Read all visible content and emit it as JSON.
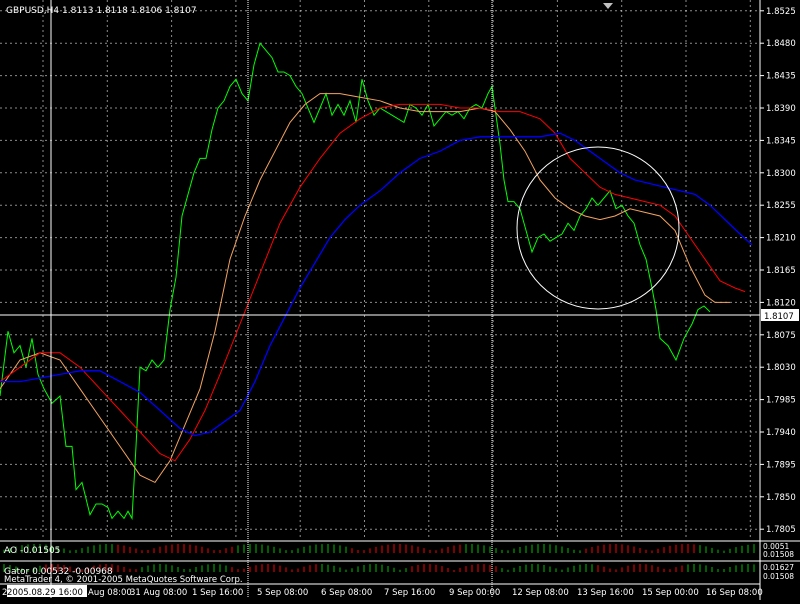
{
  "chart": {
    "symbol_info": "GBPUSD,H4  1.8113 1.8118 1.8106 1.8107",
    "current_price": "1.8107",
    "price_ticks": [
      "1.8525",
      "1.8480",
      "1.8435",
      "1.8390",
      "1.8345",
      "1.8300",
      "1.8255",
      "1.8210",
      "1.8165",
      "1.8120",
      "1.8075",
      "1.8030",
      "1.7985",
      "1.7940",
      "1.7895",
      "1.7850",
      "1.7805"
    ],
    "date_ticks": [
      "26",
      "2005.08.29 16:00",
      "Aug 08:00",
      "31 Aug 08:00",
      "1 Sep 16:00",
      "5 Sep 08:00",
      "6 Sep 08:00",
      "7 Sep 16:00",
      "9 Sep 00:00",
      "12 Sep 08:00",
      "13 Sep 16:00",
      "15 Sep 00:00",
      "16 Sep 08:00"
    ],
    "date_tick_x": [
      2,
      7,
      88,
      130,
      192,
      257,
      321,
      384,
      449,
      512,
      577,
      642,
      706
    ],
    "colors": {
      "background": "#000000",
      "grid": "#ffffff",
      "price_line": "#00ff00",
      "ma_fast": "#f4a460",
      "ma_mid": "#ff0000",
      "ma_slow": "#0000ff",
      "circle": "#ffffff"
    }
  },
  "chart_data": {
    "type": "line",
    "ylim": [
      1.779,
      1.854
    ],
    "series": [
      {
        "key": "price",
        "values": [
          [
            0,
            1.799
          ],
          [
            8,
            1.808
          ],
          [
            14,
            1.805
          ],
          [
            20,
            1.806
          ],
          [
            26,
            1.803
          ],
          [
            32,
            1.807
          ],
          [
            38,
            1.802
          ],
          [
            44,
            1.8
          ],
          [
            52,
            1.798
          ],
          [
            60,
            1.799
          ],
          [
            66,
            1.792
          ],
          [
            72,
            1.792
          ],
          [
            76,
            1.786
          ],
          [
            82,
            1.787
          ],
          [
            90,
            1.7825
          ],
          [
            96,
            1.784
          ],
          [
            102,
            1.784
          ],
          [
            108,
            1.7835
          ],
          [
            112,
            1.782
          ],
          [
            118,
            1.783
          ],
          [
            124,
            1.782
          ],
          [
            128,
            1.783
          ],
          [
            132,
            1.782
          ],
          [
            136,
            1.792
          ],
          [
            140,
            1.803
          ],
          [
            146,
            1.8025
          ],
          [
            152,
            1.804
          ],
          [
            158,
            1.803
          ],
          [
            164,
            1.804
          ],
          [
            170,
            1.811
          ],
          [
            176,
            1.8155
          ],
          [
            182,
            1.824
          ],
          [
            188,
            1.827
          ],
          [
            194,
            1.83
          ],
          [
            200,
            1.832
          ],
          [
            206,
            1.832
          ],
          [
            212,
            1.836
          ],
          [
            218,
            1.839
          ],
          [
            224,
            1.84
          ],
          [
            230,
            1.842
          ],
          [
            236,
            1.843
          ],
          [
            242,
            1.841
          ],
          [
            248,
            1.84
          ],
          [
            254,
            1.845
          ],
          [
            260,
            1.848
          ],
          [
            266,
            1.847
          ],
          [
            272,
            1.846
          ],
          [
            278,
            1.844
          ],
          [
            284,
            1.844
          ],
          [
            290,
            1.8435
          ],
          [
            296,
            1.842
          ],
          [
            302,
            1.841
          ],
          [
            308,
            1.839
          ],
          [
            314,
            1.837
          ],
          [
            320,
            1.839
          ],
          [
            326,
            1.841
          ],
          [
            332,
            1.838
          ],
          [
            338,
            1.8395
          ],
          [
            344,
            1.838
          ],
          [
            350,
            1.84
          ],
          [
            356,
            1.837
          ],
          [
            362,
            1.843
          ],
          [
            368,
            1.84
          ],
          [
            374,
            1.838
          ],
          [
            380,
            1.839
          ],
          [
            386,
            1.8385
          ],
          [
            392,
            1.838
          ],
          [
            398,
            1.8375
          ],
          [
            404,
            1.837
          ],
          [
            410,
            1.8395
          ],
          [
            416,
            1.839
          ],
          [
            422,
            1.838
          ],
          [
            428,
            1.8395
          ],
          [
            434,
            1.8365
          ],
          [
            440,
            1.8375
          ],
          [
            446,
            1.8385
          ],
          [
            452,
            1.838
          ],
          [
            458,
            1.8385
          ],
          [
            464,
            1.8375
          ],
          [
            470,
            1.839
          ],
          [
            476,
            1.8395
          ],
          [
            482,
            1.839
          ],
          [
            488,
            1.841
          ],
          [
            492,
            1.842
          ],
          [
            496,
            1.838
          ],
          [
            500,
            1.834
          ],
          [
            504,
            1.829
          ],
          [
            508,
            1.826
          ],
          [
            514,
            1.826
          ],
          [
            520,
            1.825
          ],
          [
            526,
            1.822
          ],
          [
            532,
            1.819
          ],
          [
            538,
            1.821
          ],
          [
            544,
            1.8215
          ],
          [
            550,
            1.8205
          ],
          [
            556,
            1.821
          ],
          [
            562,
            1.8215
          ],
          [
            568,
            1.823
          ],
          [
            574,
            1.822
          ],
          [
            580,
            1.824
          ],
          [
            586,
            1.825
          ],
          [
            592,
            1.8265
          ],
          [
            598,
            1.8255
          ],
          [
            604,
            1.8265
          ],
          [
            610,
            1.8275
          ],
          [
            616,
            1.825
          ],
          [
            622,
            1.8255
          ],
          [
            628,
            1.824
          ],
          [
            634,
            1.823
          ],
          [
            640,
            1.82
          ],
          [
            646,
            1.818
          ],
          [
            652,
            1.814
          ],
          [
            656,
            1.811
          ],
          [
            660,
            1.807
          ],
          [
            668,
            1.806
          ],
          [
            676,
            1.804
          ],
          [
            684,
            1.807
          ],
          [
            692,
            1.809
          ],
          [
            698,
            1.811
          ],
          [
            704,
            1.8115
          ],
          [
            710,
            1.8107
          ]
        ]
      },
      {
        "key": "ma_fast",
        "values": [
          [
            0,
            1.8
          ],
          [
            20,
            1.804
          ],
          [
            40,
            1.805
          ],
          [
            60,
            1.804
          ],
          [
            80,
            1.8
          ],
          [
            100,
            1.796
          ],
          [
            120,
            1.792
          ],
          [
            140,
            1.788
          ],
          [
            155,
            1.787
          ],
          [
            170,
            1.79
          ],
          [
            185,
            1.795
          ],
          [
            200,
            1.8
          ],
          [
            215,
            1.808
          ],
          [
            230,
            1.818
          ],
          [
            245,
            1.824
          ],
          [
            260,
            1.829
          ],
          [
            275,
            1.833
          ],
          [
            290,
            1.837
          ],
          [
            305,
            1.8395
          ],
          [
            320,
            1.841
          ],
          [
            340,
            1.841
          ],
          [
            360,
            1.8405
          ],
          [
            380,
            1.84
          ],
          [
            400,
            1.839
          ],
          [
            420,
            1.8385
          ],
          [
            440,
            1.8385
          ],
          [
            460,
            1.8385
          ],
          [
            480,
            1.839
          ],
          [
            495,
            1.8385
          ],
          [
            510,
            1.836
          ],
          [
            525,
            1.833
          ],
          [
            540,
            1.829
          ],
          [
            555,
            1.8265
          ],
          [
            570,
            1.825
          ],
          [
            585,
            1.824
          ],
          [
            600,
            1.8235
          ],
          [
            615,
            1.824
          ],
          [
            630,
            1.825
          ],
          [
            645,
            1.8245
          ],
          [
            660,
            1.824
          ],
          [
            675,
            1.822
          ],
          [
            690,
            1.817
          ],
          [
            705,
            1.813
          ],
          [
            715,
            1.812
          ],
          [
            730,
            1.812
          ]
        ]
      },
      {
        "key": "ma_mid",
        "values": [
          [
            0,
            1.801
          ],
          [
            20,
            1.803
          ],
          [
            40,
            1.805
          ],
          [
            60,
            1.805
          ],
          [
            80,
            1.803
          ],
          [
            100,
            1.8
          ],
          [
            120,
            1.797
          ],
          [
            140,
            1.794
          ],
          [
            160,
            1.791
          ],
          [
            175,
            1.79
          ],
          [
            190,
            1.793
          ],
          [
            205,
            1.797
          ],
          [
            220,
            1.802
          ],
          [
            240,
            1.809
          ],
          [
            260,
            1.816
          ],
          [
            280,
            1.823
          ],
          [
            300,
            1.828
          ],
          [
            320,
            1.832
          ],
          [
            340,
            1.8355
          ],
          [
            360,
            1.8375
          ],
          [
            380,
            1.839
          ],
          [
            400,
            1.8395
          ],
          [
            420,
            1.8395
          ],
          [
            440,
            1.8395
          ],
          [
            460,
            1.839
          ],
          [
            480,
            1.839
          ],
          [
            500,
            1.8385
          ],
          [
            520,
            1.8385
          ],
          [
            540,
            1.8375
          ],
          [
            555,
            1.8355
          ],
          [
            570,
            1.832
          ],
          [
            585,
            1.83
          ],
          [
            600,
            1.828
          ],
          [
            615,
            1.827
          ],
          [
            630,
            1.8265
          ],
          [
            645,
            1.826
          ],
          [
            660,
            1.8255
          ],
          [
            675,
            1.824
          ],
          [
            690,
            1.821
          ],
          [
            705,
            1.818
          ],
          [
            720,
            1.815
          ],
          [
            735,
            1.814
          ],
          [
            745,
            1.8135
          ]
        ]
      },
      {
        "key": "ma_slow",
        "values": [
          [
            0,
            1.801
          ],
          [
            20,
            1.801
          ],
          [
            40,
            1.8015
          ],
          [
            60,
            1.802
          ],
          [
            80,
            1.8025
          ],
          [
            100,
            1.8025
          ],
          [
            120,
            1.801
          ],
          [
            140,
            1.7995
          ],
          [
            160,
            1.797
          ],
          [
            180,
            1.7945
          ],
          [
            195,
            1.7935
          ],
          [
            210,
            1.794
          ],
          [
            225,
            1.7955
          ],
          [
            240,
            1.797
          ],
          [
            255,
            1.801
          ],
          [
            270,
            1.806
          ],
          [
            285,
            1.81
          ],
          [
            300,
            1.814
          ],
          [
            315,
            1.8175
          ],
          [
            330,
            1.821
          ],
          [
            345,
            1.8235
          ],
          [
            360,
            1.8255
          ],
          [
            380,
            1.8275
          ],
          [
            400,
            1.83
          ],
          [
            420,
            1.832
          ],
          [
            440,
            1.833
          ],
          [
            460,
            1.8345
          ],
          [
            480,
            1.835
          ],
          [
            500,
            1.835
          ],
          [
            520,
            1.835
          ],
          [
            540,
            1.835
          ],
          [
            560,
            1.8355
          ],
          [
            575,
            1.8345
          ],
          [
            590,
            1.833
          ],
          [
            605,
            1.8315
          ],
          [
            620,
            1.83
          ],
          [
            635,
            1.829
          ],
          [
            650,
            1.8285
          ],
          [
            665,
            1.828
          ],
          [
            680,
            1.8275
          ],
          [
            695,
            1.827
          ],
          [
            710,
            1.8255
          ],
          [
            725,
            1.8235
          ],
          [
            740,
            1.8215
          ],
          [
            752,
            1.82
          ]
        ]
      }
    ]
  },
  "indicators": {
    "ao_label": "AO -0.01505",
    "ao_right_top": "0.0051",
    "ao_right_bottom": "0.01508",
    "gator_label": "Gator 0.00532 -0.00968",
    "gator_right_top": "0.01627",
    "gator_right_bottom": "0.01508",
    "watermark": "MetaTrader 4, © 2001-2005 MetaQuotes Software Corp."
  }
}
